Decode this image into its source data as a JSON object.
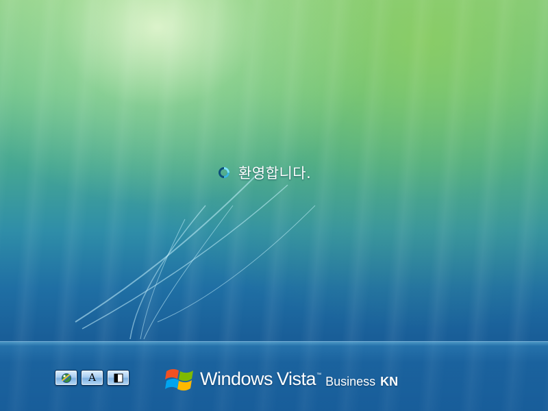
{
  "screen": {
    "status_text": "환영합니다.",
    "status_icon": "busy-spinner-icon"
  },
  "ease_of_access": {
    "buttons": [
      {
        "icon": "ease-of-access-icon"
      },
      {
        "icon": "font-icon",
        "glyph": "A"
      },
      {
        "icon": "high-contrast-icon"
      }
    ]
  },
  "branding": {
    "logo_icon": "windows-flag-icon",
    "word_windows": "Windows",
    "word_vista": "Vista",
    "trademark": "™",
    "edition": "Business",
    "edition_suffix": "KN"
  },
  "colors": {
    "background_top": "#8fd08a",
    "background_bottom": "#1a5f97",
    "text": "#ffffff"
  }
}
